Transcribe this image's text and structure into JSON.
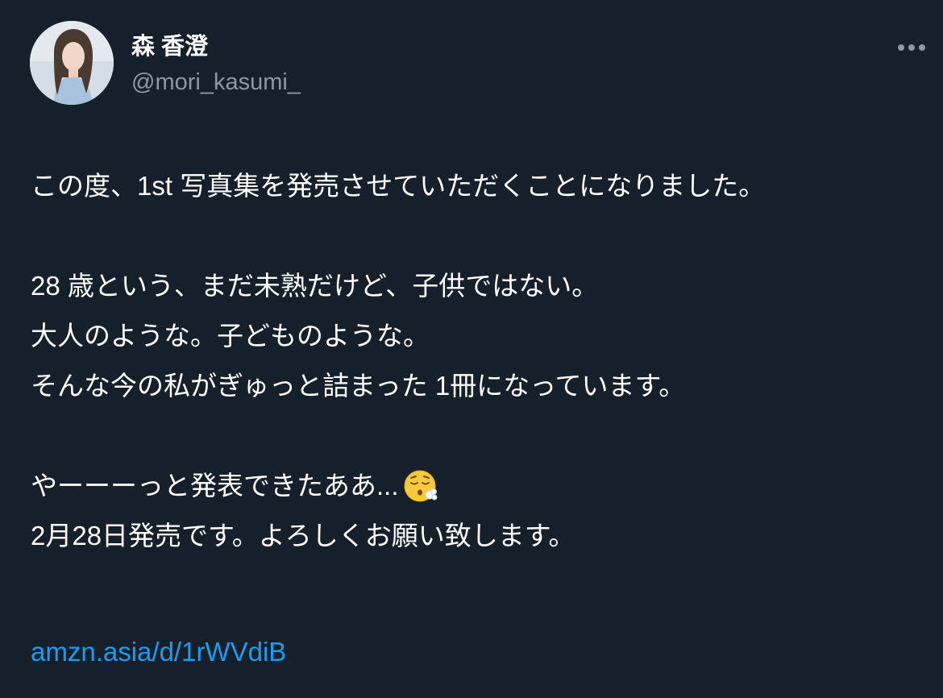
{
  "author": {
    "display_name": "森 香澄",
    "handle": "@mori_kasumi_"
  },
  "tweet": {
    "lines": {
      "l1": "この度、1st 写真集を発売させていただくことになりました。",
      "l2": "28 歳という、まだ未熟だけど、子供ではない。",
      "l3": "大人のような。子どものような。",
      "l4": "そんな今の私がぎゅっと詰まった 1冊になっています。",
      "l5": "やーーーっと発表できたああ...",
      "l6": "2月28日発売です。よろしくお願い致します。"
    },
    "link": "amzn.asia/d/1rWVdiB"
  },
  "icons": {
    "more": "more-horizontal-icon",
    "emoji": "face-exhaling-emoji"
  },
  "colors": {
    "background": "#15202b",
    "text": "#ffffff",
    "secondary_text": "#8b98a5",
    "link": "#1d9bf0"
  }
}
